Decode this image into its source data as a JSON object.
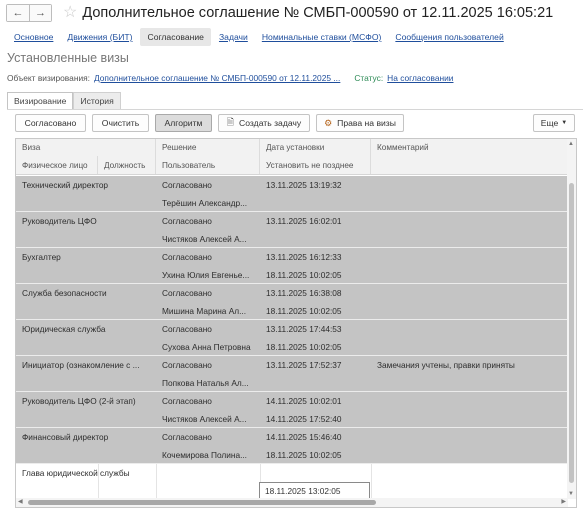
{
  "window": {
    "back_icon": "arrow-left-icon",
    "forward_icon": "arrow-right-icon",
    "favorite_icon": "star-icon",
    "title": "Дополнительное соглашение № СМБП-000590 от 12.11.2025 16:05:21"
  },
  "nav_links": [
    {
      "label": "Основное",
      "active": false
    },
    {
      "label": "Движения (БИТ)",
      "active": false
    },
    {
      "label": "Согласование",
      "active": true
    },
    {
      "label": "Задачи",
      "active": false
    },
    {
      "label": "Номинальные ставки (МСФО)",
      "active": false
    },
    {
      "label": "Сообщения пользователей",
      "active": false
    }
  ],
  "section_title": "Установленные визы",
  "object": {
    "label": "Объект визирования:",
    "link": "Дополнительное соглашение № СМБП-000590 от 12.11.2025 ...",
    "status_label": "Статус:",
    "status_value": "На согласовании"
  },
  "tabs": [
    {
      "label": "Визирование",
      "active": true
    },
    {
      "label": "История",
      "active": false
    }
  ],
  "toolbar": {
    "approved": "Согласовано",
    "clear": "Очистить",
    "algorithm": "Алгоритм",
    "create_task": "Создать задачу",
    "visa_rights": "Права на визы",
    "more": "Еще"
  },
  "table": {
    "header_top": [
      "Виза",
      "Решение",
      "Дата установки",
      "Комментарий"
    ],
    "header_bottom": [
      "Физическое лицо",
      "Должность",
      "Пользователь",
      "Установить не позднее"
    ],
    "rows": [
      {
        "visa": "Технический директор",
        "decision": "Согласовано",
        "date_set": "13.11.2025 13:19:32",
        "user": "Терёшин Александр...",
        "deadline": "",
        "comment": ""
      },
      {
        "visa": "Руководитель ЦФО",
        "decision": "Согласовано",
        "date_set": "13.11.2025 16:02:01",
        "user": "Чистяков Алексей А...",
        "deadline": "",
        "comment": ""
      },
      {
        "visa": "Бухгалтер",
        "decision": "Согласовано",
        "date_set": "13.11.2025 16:12:33",
        "user": "Ухина Юлия Евгенье...",
        "deadline": "18.11.2025 10:02:05",
        "comment": ""
      },
      {
        "visa": "Служба безопасности",
        "decision": "Согласовано",
        "date_set": "13.11.2025 16:38:08",
        "user": "Мишина Марина Ал...",
        "deadline": "18.11.2025 10:02:05",
        "comment": ""
      },
      {
        "visa": "Юридическая служба",
        "decision": "Согласовано",
        "date_set": "13.11.2025 17:44:53",
        "user": "Сухова Анна Петровна",
        "deadline": "18.11.2025 10:02:05",
        "comment": ""
      },
      {
        "visa": "Инициатор (ознакомление с ...",
        "decision": "Согласовано",
        "date_set": "13.11.2025 17:52:37",
        "user": "Попкова Наталья Ал...",
        "deadline": "",
        "comment": "Замечания учтены, правки приняты"
      },
      {
        "visa": "Руководитель ЦФО (2-й этап)",
        "decision": "Согласовано",
        "date_set": "14.11.2025 10:02:01",
        "user": "Чистяков Алексей А...",
        "deadline": "14.11.2025 17:52:40",
        "comment": ""
      },
      {
        "visa": "Финансовый директор",
        "decision": "Согласовано",
        "date_set": "14.11.2025 15:46:40",
        "user": "Кочемирова Полина...",
        "deadline": "18.11.2025 10:02:05",
        "comment": ""
      },
      {
        "visa": "Глава юридической службы",
        "decision": "",
        "date_set": "",
        "user": "",
        "deadline": "18.11.2025 13:02:05",
        "comment": ""
      }
    ]
  },
  "colors": {
    "link": "#1f4e9c",
    "status_label": "#2e8b57",
    "row_approved": "#c4c4c4",
    "row_pending": "#ffffff"
  }
}
